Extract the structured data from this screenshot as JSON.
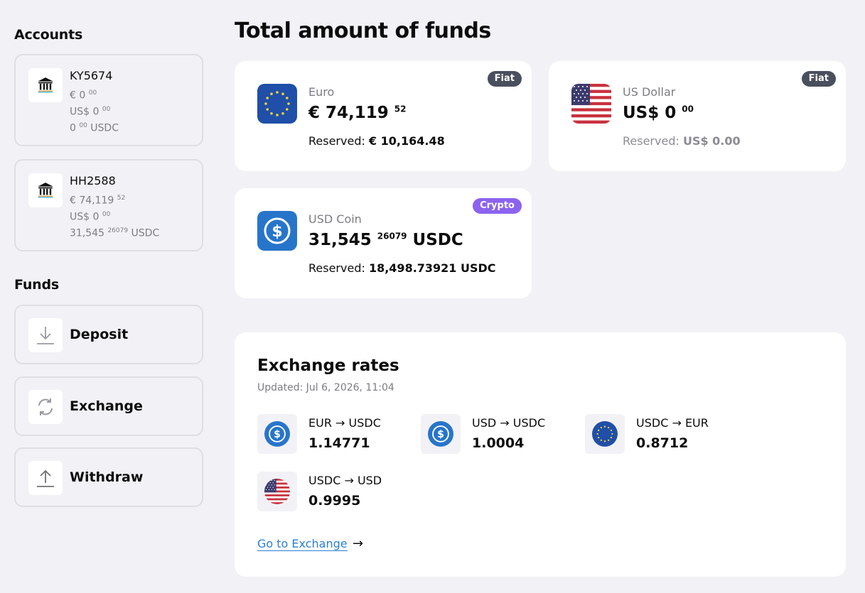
{
  "sidebar": {
    "accounts_heading": "Accounts",
    "accounts": [
      {
        "name": "KY5674",
        "eur": "€ 0",
        "eur_dec": "00",
        "usd": "US$ 0",
        "usd_dec": "00",
        "usdc": "0",
        "usdc_dec": "00",
        "usdc_unit": "USDC"
      },
      {
        "name": "HH2588",
        "eur": "€ 74,119",
        "eur_dec": "52",
        "usd": "US$ 0",
        "usd_dec": "00",
        "usdc": "31,545",
        "usdc_dec": "26079",
        "usdc_unit": "USDC"
      }
    ],
    "funds_heading": "Funds",
    "funds": [
      {
        "label": "Deposit",
        "icon": "download-icon"
      },
      {
        "label": "Exchange",
        "icon": "refresh-icon"
      },
      {
        "label": "Withdraw",
        "icon": "upload-icon"
      }
    ]
  },
  "main": {
    "title": "Total amount of funds",
    "balances": [
      {
        "name": "Euro",
        "amount": "€ 74,119",
        "amount_dec": "52",
        "reserved_label": "Reserved:",
        "reserved_value": "€ 10,164.48",
        "badge": "Fiat",
        "icon": "eu-flag-icon"
      },
      {
        "name": "US Dollar",
        "amount": "US$ 0",
        "amount_dec": "00",
        "reserved_label": "Reserved:",
        "reserved_value": "US$ 0.00",
        "badge": "Fiat",
        "icon": "us-flag-icon"
      },
      {
        "name": "USD Coin",
        "amount": "31,545",
        "amount_dec": "26079",
        "amount_unit": "USDC",
        "reserved_label": "Reserved:",
        "reserved_value": "18,498.73921 USDC",
        "badge": "Crypto",
        "icon": "usdc-icon"
      }
    ],
    "rates": {
      "title": "Exchange rates",
      "updated": "Updated: Jul 6, 2026, 11:04",
      "items": [
        {
          "pair": "EUR → USDC",
          "value": "1.14771",
          "icon": "usdc-icon"
        },
        {
          "pair": "USD → USDC",
          "value": "1.0004",
          "icon": "usdc-icon"
        },
        {
          "pair": "USDC → EUR",
          "value": "0.8712",
          "icon": "eu-flag-icon"
        },
        {
          "pair": "USDC → USD",
          "value": "0.9995",
          "icon": "us-flag-icon"
        }
      ],
      "link_label": "Go to Exchange",
      "link_arrow": "→"
    }
  },
  "colors": {
    "background": "#f2f2f6",
    "card": "#ffffff",
    "fiat_badge": "#4a4f5e",
    "crypto_badge": "#8b63f0",
    "link": "#2a7fd4",
    "usdc_blue": "#2775ca",
    "eu_blue": "#1f4fa8"
  }
}
